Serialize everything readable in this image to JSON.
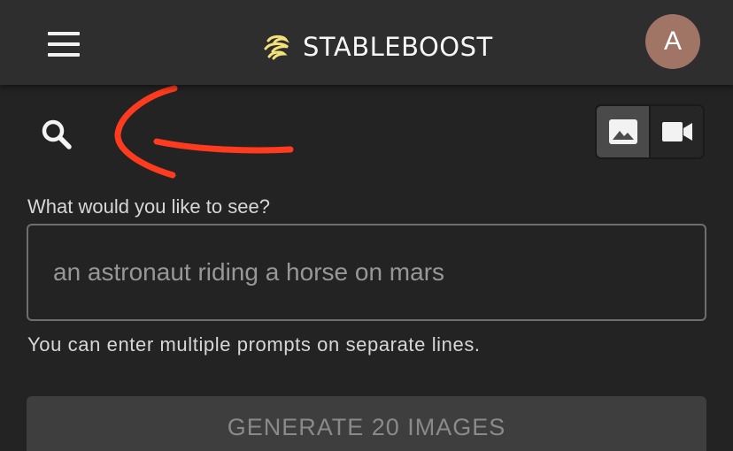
{
  "header": {
    "brand_name": "STABLEBOOST",
    "avatar_initial": "A",
    "menu_icon": "hamburger-menu-icon",
    "logo_icon": "stableboost-logo-icon",
    "logo_color": "#f3e27a"
  },
  "toolbar": {
    "search_icon": "search-icon",
    "annotation_color": "#ff3b1f",
    "mode_toggle": {
      "selected": "image",
      "options": [
        {
          "mode": "image",
          "icon": "image-icon"
        },
        {
          "mode": "video",
          "icon": "video-camera-icon"
        }
      ]
    }
  },
  "prompt": {
    "label": "What would you like to see?",
    "placeholder": "an astronaut riding a horse on mars",
    "value": "",
    "helper": "You can enter multiple prompts on separate lines."
  },
  "actions": {
    "generate_label": "GENERATE 20 IMAGES",
    "generate_enabled": false
  },
  "colors": {
    "background": "#232323",
    "appbar": "#2e2e2e",
    "avatar": "#a07565"
  }
}
